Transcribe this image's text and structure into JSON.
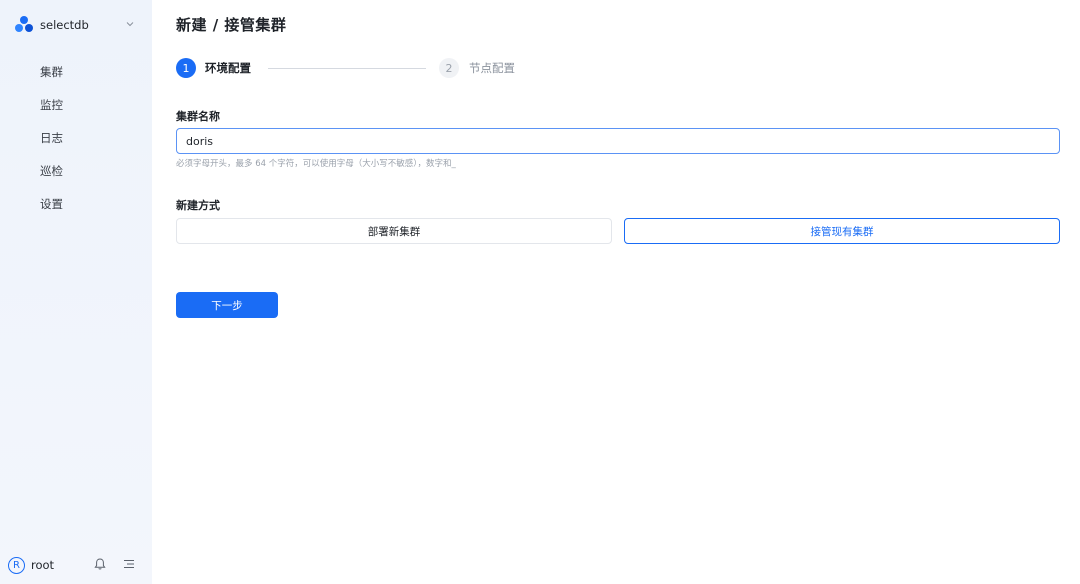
{
  "brand": {
    "name": "selectdb",
    "accent_color": "#1a6cf5"
  },
  "sidebar": {
    "items": [
      {
        "label": "集群"
      },
      {
        "label": "监控"
      },
      {
        "label": "日志"
      },
      {
        "label": "巡检"
      },
      {
        "label": "设置"
      }
    ],
    "footer": {
      "avatar_letter": "R",
      "username": "root",
      "icons": [
        "bell-icon",
        "menu-toggle-icon"
      ]
    }
  },
  "page": {
    "title": "新建 / 接管集群"
  },
  "steps": [
    {
      "number": "1",
      "label": "环境配置",
      "status": "active"
    },
    {
      "number": "2",
      "label": "节点配置",
      "status": "inactive"
    }
  ],
  "form": {
    "cluster_name": {
      "label": "集群名称",
      "value": "doris",
      "hint": "必须字母开头，最多 64 个字符，可以使用字母（大小写不敏感），数字和_"
    },
    "create_mode": {
      "label": "新建方式",
      "options": [
        {
          "label": "部署新集群",
          "selected": false
        },
        {
          "label": "接管现有集群",
          "selected": true
        }
      ]
    },
    "next_label": "下一步"
  }
}
